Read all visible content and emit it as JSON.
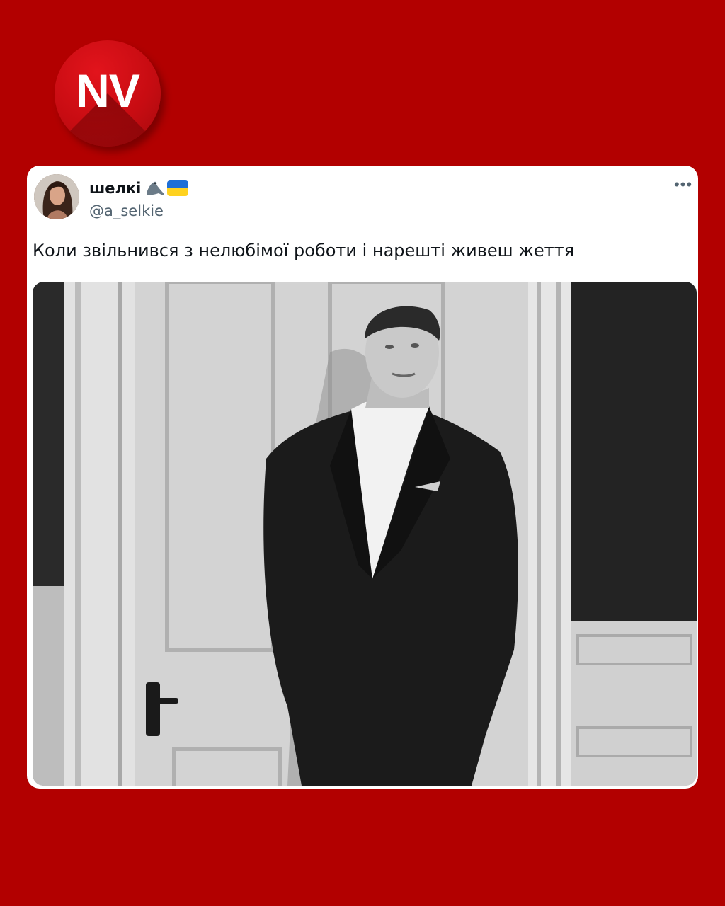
{
  "brand": {
    "logo_text": "NV"
  },
  "tweet": {
    "display_name": "шелкі",
    "name_emoji_icons": [
      "seal-icon",
      "ukraine-flag-icon"
    ],
    "handle": "@a_selkie",
    "more_icon": "more-horizontal-icon",
    "text": "Коли звільнився з нелюбімої роботи і нарешті живеш жеття"
  },
  "colors": {
    "background": "#b20000",
    "logo_red": "#d0101a",
    "card": "#ffffff",
    "name_text": "#0f1419",
    "secondary_text": "#536471"
  }
}
